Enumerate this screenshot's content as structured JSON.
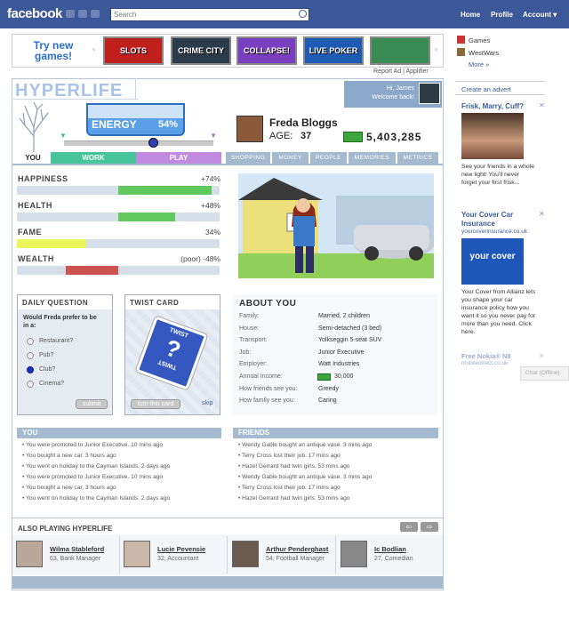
{
  "fb": {
    "logo": "facebook",
    "search_placeholder": "Search",
    "nav": [
      "Home",
      "Profile",
      "Account ▾"
    ]
  },
  "ad_strip": {
    "try_new": "Try new games!",
    "games": [
      {
        "label": "SLOTS",
        "color": "#c0201d"
      },
      {
        "label": "CRIME CITY",
        "color": "#2c3b4a"
      },
      {
        "label": "COLLAPSE!",
        "color": "#7a3ec0"
      },
      {
        "label": "LIVE POKER",
        "color": "#1e5bb5"
      },
      {
        "label": "",
        "color": "#3a8a54"
      }
    ],
    "report": "Report Ad | Applifier"
  },
  "right": {
    "apps": [
      "Games",
      "WestWars"
    ],
    "more": "More »",
    "create_advert": "Create an advert",
    "ads": [
      {
        "title": "Frisk, Marry, Cuff?",
        "text": "See your friends in a whole new light! You'll never forget your first frisk..."
      },
      {
        "title": "Your Cover Car Insurance",
        "sub": "yourcoverinsurance.co.uk",
        "logo": "your cover",
        "text": "Your Cover from Allianz lets you shape your car insurance policy how you want it so you never pay for more than you need. Click here."
      },
      {
        "title": "Free Nokia® N8",
        "sub": "mobiledirect.co.uk"
      }
    ],
    "chat": "Chat (Offline)"
  },
  "app": {
    "logo": "HYPERLIFE",
    "greeting": "Hi, James",
    "welcome": "Welcome back!",
    "energy_label": "ENERGY",
    "energy_value": "54%",
    "energy_fraction": 0.54,
    "profile": {
      "name": "Freda Bloggs",
      "age_label": "AGE:",
      "age": "37",
      "money": "5,403,285"
    },
    "tabs": {
      "you": "YOU",
      "work": "WORK",
      "play": "PLAY"
    },
    "subtabs": [
      "SHOPPING",
      "MONEY",
      "PEOPLE",
      "MEMORIES",
      "METRICS"
    ],
    "stats": [
      {
        "label": "HAPPINESS",
        "value": "+74%",
        "fill_from": 0.5,
        "fill_to": 0.96,
        "color": "#5fc95f"
      },
      {
        "label": "HEALTH",
        "value": "+48%",
        "fill_from": 0.5,
        "fill_to": 0.78,
        "color": "#5fc95f"
      },
      {
        "label": "FAME",
        "value": "34%",
        "fill_from": 0.0,
        "fill_to": 0.34,
        "color": "#eaf55a"
      },
      {
        "label": "WEALTH",
        "value": "(poor) -48%",
        "fill_from": 0.24,
        "fill_to": 0.5,
        "color": "#cf5252"
      }
    ],
    "daily_question": {
      "title": "DAILY QUESTION",
      "question": "Would Freda prefer to be in a:",
      "options": [
        "Restaurant?",
        "Pub?",
        "Club?",
        "Cinema?"
      ],
      "selected": 2,
      "submit": "submit"
    },
    "twist": {
      "title": "TWIST CARD",
      "card_top": "TWIST",
      "card_bottom": "TWIST",
      "turn": "turn this card",
      "skip": "skip"
    },
    "about": {
      "title": "ABOUT YOU",
      "rows": [
        {
          "k": "Family:",
          "v": "Married, 2 children"
        },
        {
          "k": "House:",
          "v": "Semi-detached (3 bed)"
        },
        {
          "k": "Transport:",
          "v": "Yolkseggin 5-seat SUV"
        },
        {
          "k": "Job:",
          "v": "Junior Executive"
        },
        {
          "k": "Employer:",
          "v": "Watt Industries"
        },
        {
          "k": "Annual Income:",
          "v": "30,000"
        },
        {
          "k": "How friends see you:",
          "v": "Greedy"
        },
        {
          "k": "How family see you:",
          "v": "Caring"
        }
      ]
    },
    "feed_you": {
      "title": "YOU",
      "items": [
        "• You were promoted to Junior Executive. 10 mins ago",
        "• You bought a new car. 3 hours ago",
        "• You went on holiday to the Cayman Islands. 2 days ago",
        "• You were promoted to Junior Executive. 10 mins ago",
        "• You bought a new car. 3 hours ago",
        "• You went on holiday to the Cayman Islands. 2 days ago"
      ]
    },
    "feed_friends": {
      "title": "FRIENDS",
      "items": [
        "• Wendy Gable bought an antique vase. 3 mins ago",
        "• Terry Cross lost their job. 17 mins ago",
        "• Hazel Gerrard had twin girls. 53 mins ago",
        "• Wendy Gable bought an antique vase. 3 mins ago",
        "• Terry Cross lost their job. 17 mins ago",
        "• Hazel Gerrard had twin girls. 53 mins ago"
      ]
    },
    "also_playing": {
      "title": "ALSO PLAYING HYPERLIFE",
      "players": [
        {
          "name": "Wilma Stableford",
          "desc": "63, Bank Manager"
        },
        {
          "name": "Lucie Pevensie",
          "desc": "32, Accountant"
        },
        {
          "name": "Arthur Penderghast",
          "desc": "54, Football Manager"
        },
        {
          "name": "Ic Bodlian",
          "desc": "27, Comedian"
        }
      ]
    }
  }
}
